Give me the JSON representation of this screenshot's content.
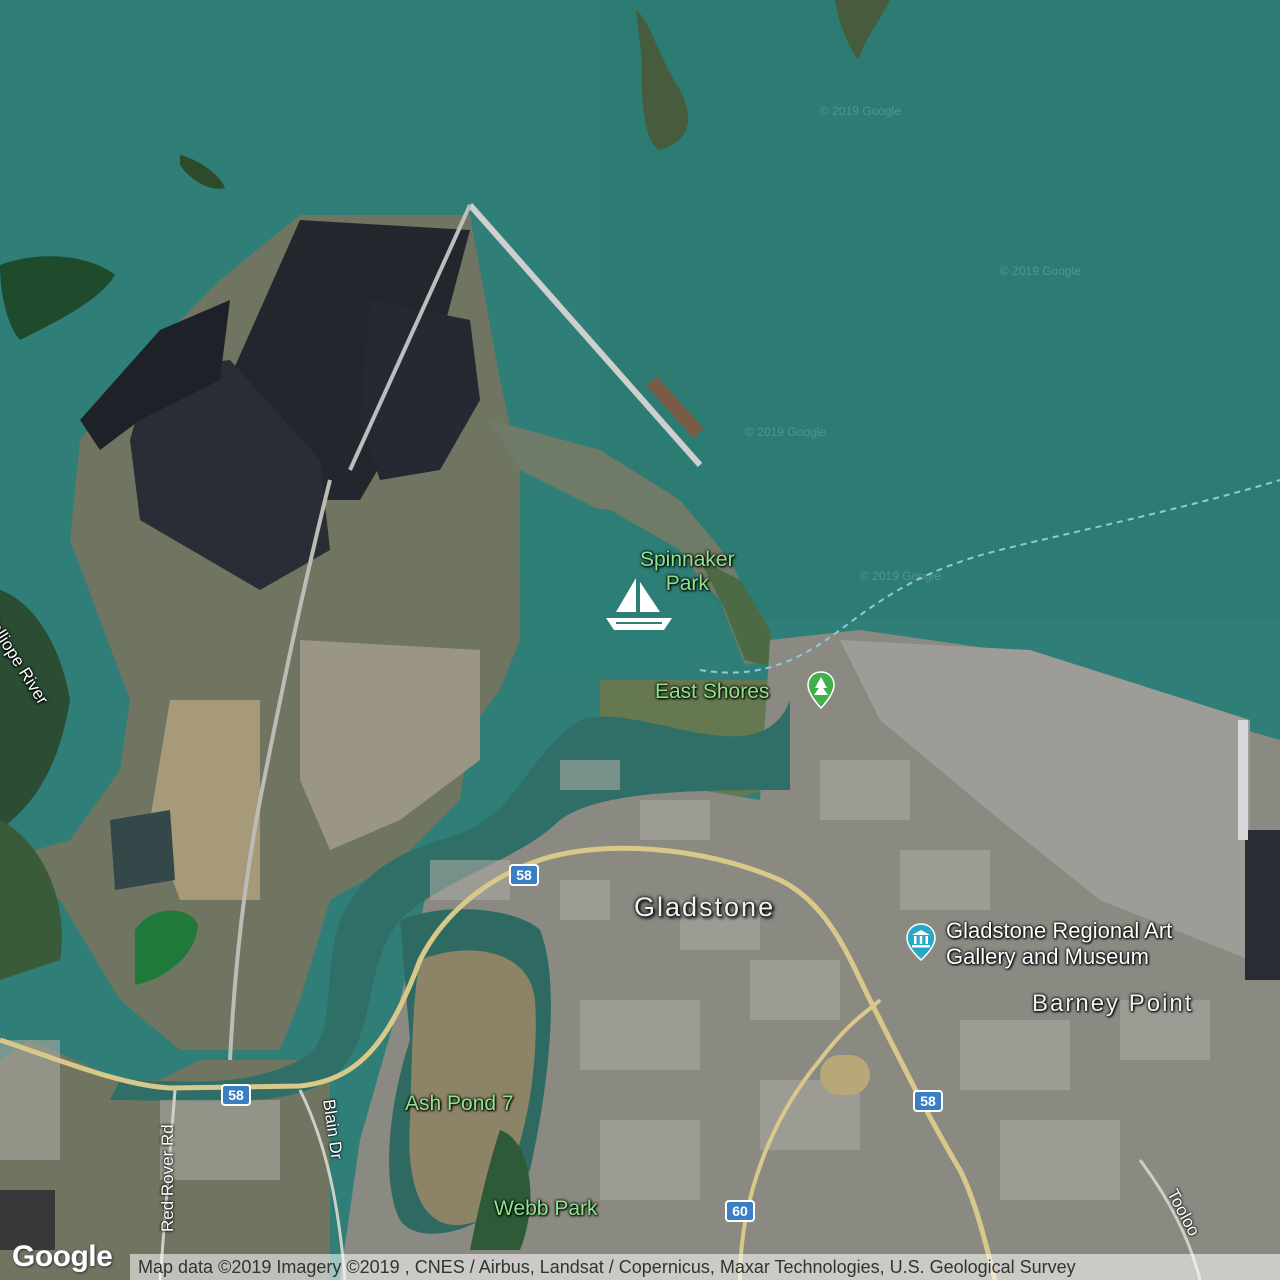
{
  "map": {
    "colors": {
      "water": "#2f7f78",
      "water_deep": "#2a746c",
      "land": "#6e7a5a",
      "mangrove": "#1f4a2c",
      "coal": "#232530",
      "urban": "#8c8c86",
      "highway": "#d8c88a",
      "shield": "#3a7fc4",
      "poi_green": "#8ee58c",
      "museum_pin": "#25a9c4",
      "park_pin": "#3fb04a"
    }
  },
  "labels": {
    "spinnaker_park": "Spinnaker\nPark",
    "east_shores": "East Shores",
    "calliope_river": "Calliope River",
    "gladstone": "Gladstone",
    "art_gallery": "Gladstone Regional Art\nGallery and Museum",
    "barney_point": "Barney Point",
    "ash_pond": "Ash Pond 7",
    "webb_park": "Webb Park",
    "red_rover_rd": "Red Rover Rd",
    "blain_dr": "Blain Dr",
    "tooloola": "Tooloo"
  },
  "shields": {
    "route_58": "58",
    "route_60": "60"
  },
  "icons": {
    "marina": "sailboat-icon",
    "park": "tree-pin-icon",
    "museum": "museum-pin-icon"
  },
  "footer": {
    "logo": "Google",
    "attribution": "Map data ©2019  Imagery ©2019 , CNES / Airbus, Landsat / Copernicus, Maxar Technologies, U.S. Geological Survey"
  },
  "watermark": "© 2019 Google"
}
